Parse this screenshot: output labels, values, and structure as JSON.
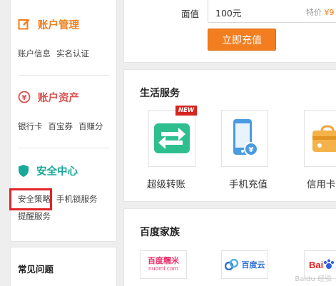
{
  "sidebar": {
    "account_manage": {
      "title": "账户管理",
      "links": [
        "账户信息",
        "实名认证"
      ]
    },
    "account_assets": {
      "title": "账户资产",
      "links": [
        "银行卡",
        "百宝券",
        "百赚分"
      ]
    },
    "security": {
      "title": "安全中心",
      "links": [
        "安全策略",
        "手机锁服务",
        "提醒服务"
      ]
    },
    "faq_title": "常见问题"
  },
  "recharge": {
    "face_value_label": "面值",
    "amount": "100元",
    "price_label": "特价",
    "price_value": "¥9",
    "button": "立即充值"
  },
  "life_services": {
    "title": "生活服务",
    "new_badge": "NEW",
    "items": [
      {
        "label": "超级转账",
        "icon": "transfer-icon"
      },
      {
        "label": "手机充值",
        "icon": "phone-recharge-icon"
      },
      {
        "label": "信用卡",
        "icon": "credit-card-icon"
      }
    ]
  },
  "baidu_family": {
    "title": "百度家族",
    "logos": [
      {
        "icon": "nuomi-logo",
        "main": "百度糯米",
        "sub": "nuomi.com"
      },
      {
        "icon": "baidu-cloud-logo",
        "main": "百度云"
      },
      {
        "icon": "baidu-logo",
        "main": "Bai"
      }
    ]
  },
  "watermark": "Baidu 经验",
  "colors": {
    "orange_accent": "#f07d1a",
    "red_accent": "#d9534f",
    "teal_accent": "#1aa89a",
    "highlight": "#e0262a"
  }
}
